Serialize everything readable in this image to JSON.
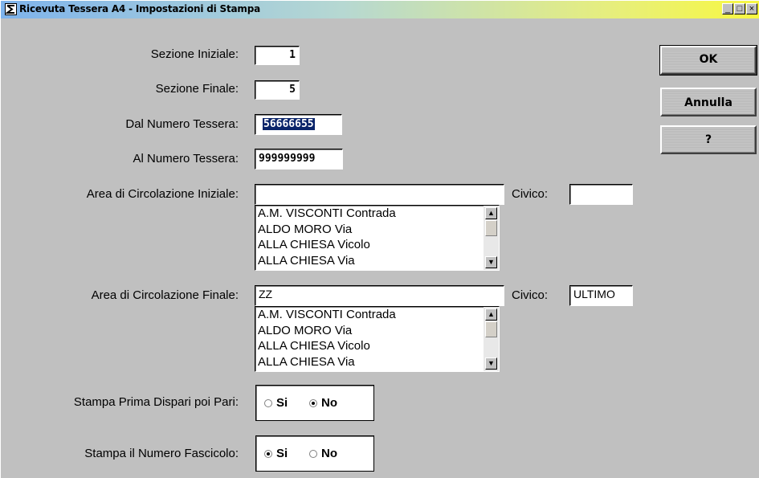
{
  "window": {
    "title": "Ricevuta Tessera A4 - Impostazioni di Stampa",
    "controls": {
      "minimize": "_",
      "maximize": "□",
      "close": "×"
    }
  },
  "fields": {
    "sezione_iniziale": {
      "label": "Sezione Iniziale:",
      "value": "1"
    },
    "sezione_finale": {
      "label": "Sezione Finale:",
      "value": "5"
    },
    "dal_numero": {
      "label": "Dal Numero Tessera:",
      "value": "56666655"
    },
    "al_numero": {
      "label": "Al Numero Tessera:",
      "value": "999999999"
    }
  },
  "area_iniziale": {
    "label": "Area di Circolazione Iniziale:",
    "value": "",
    "civico_label": "Civico:",
    "civico_value": "",
    "list": [
      "A.M. VISCONTI Contrada",
      "ALDO MORO Via",
      "ALLA CHIESA Vicolo",
      "ALLA CHIESA Via"
    ]
  },
  "area_finale": {
    "label": "Area di Circolazione  Finale:",
    "value": "ZZ",
    "civico_label": "Civico:",
    "civico_value": "ULTIMO",
    "list": [
      "A.M. VISCONTI Contrada",
      "ALDO MORO Via",
      "ALLA CHIESA Vicolo",
      "ALLA CHIESA Via"
    ]
  },
  "options": {
    "dispari_pari": {
      "label": "Stampa Prima Dispari poi Pari:",
      "si": "Si",
      "no": "No",
      "selected": "No"
    },
    "fascicolo": {
      "label": "Stampa il Numero Fascicolo:",
      "si": "Si",
      "no": "No",
      "selected": "Si"
    }
  },
  "buttons": {
    "ok": "OK",
    "annulla": "Annulla",
    "help": "?"
  }
}
